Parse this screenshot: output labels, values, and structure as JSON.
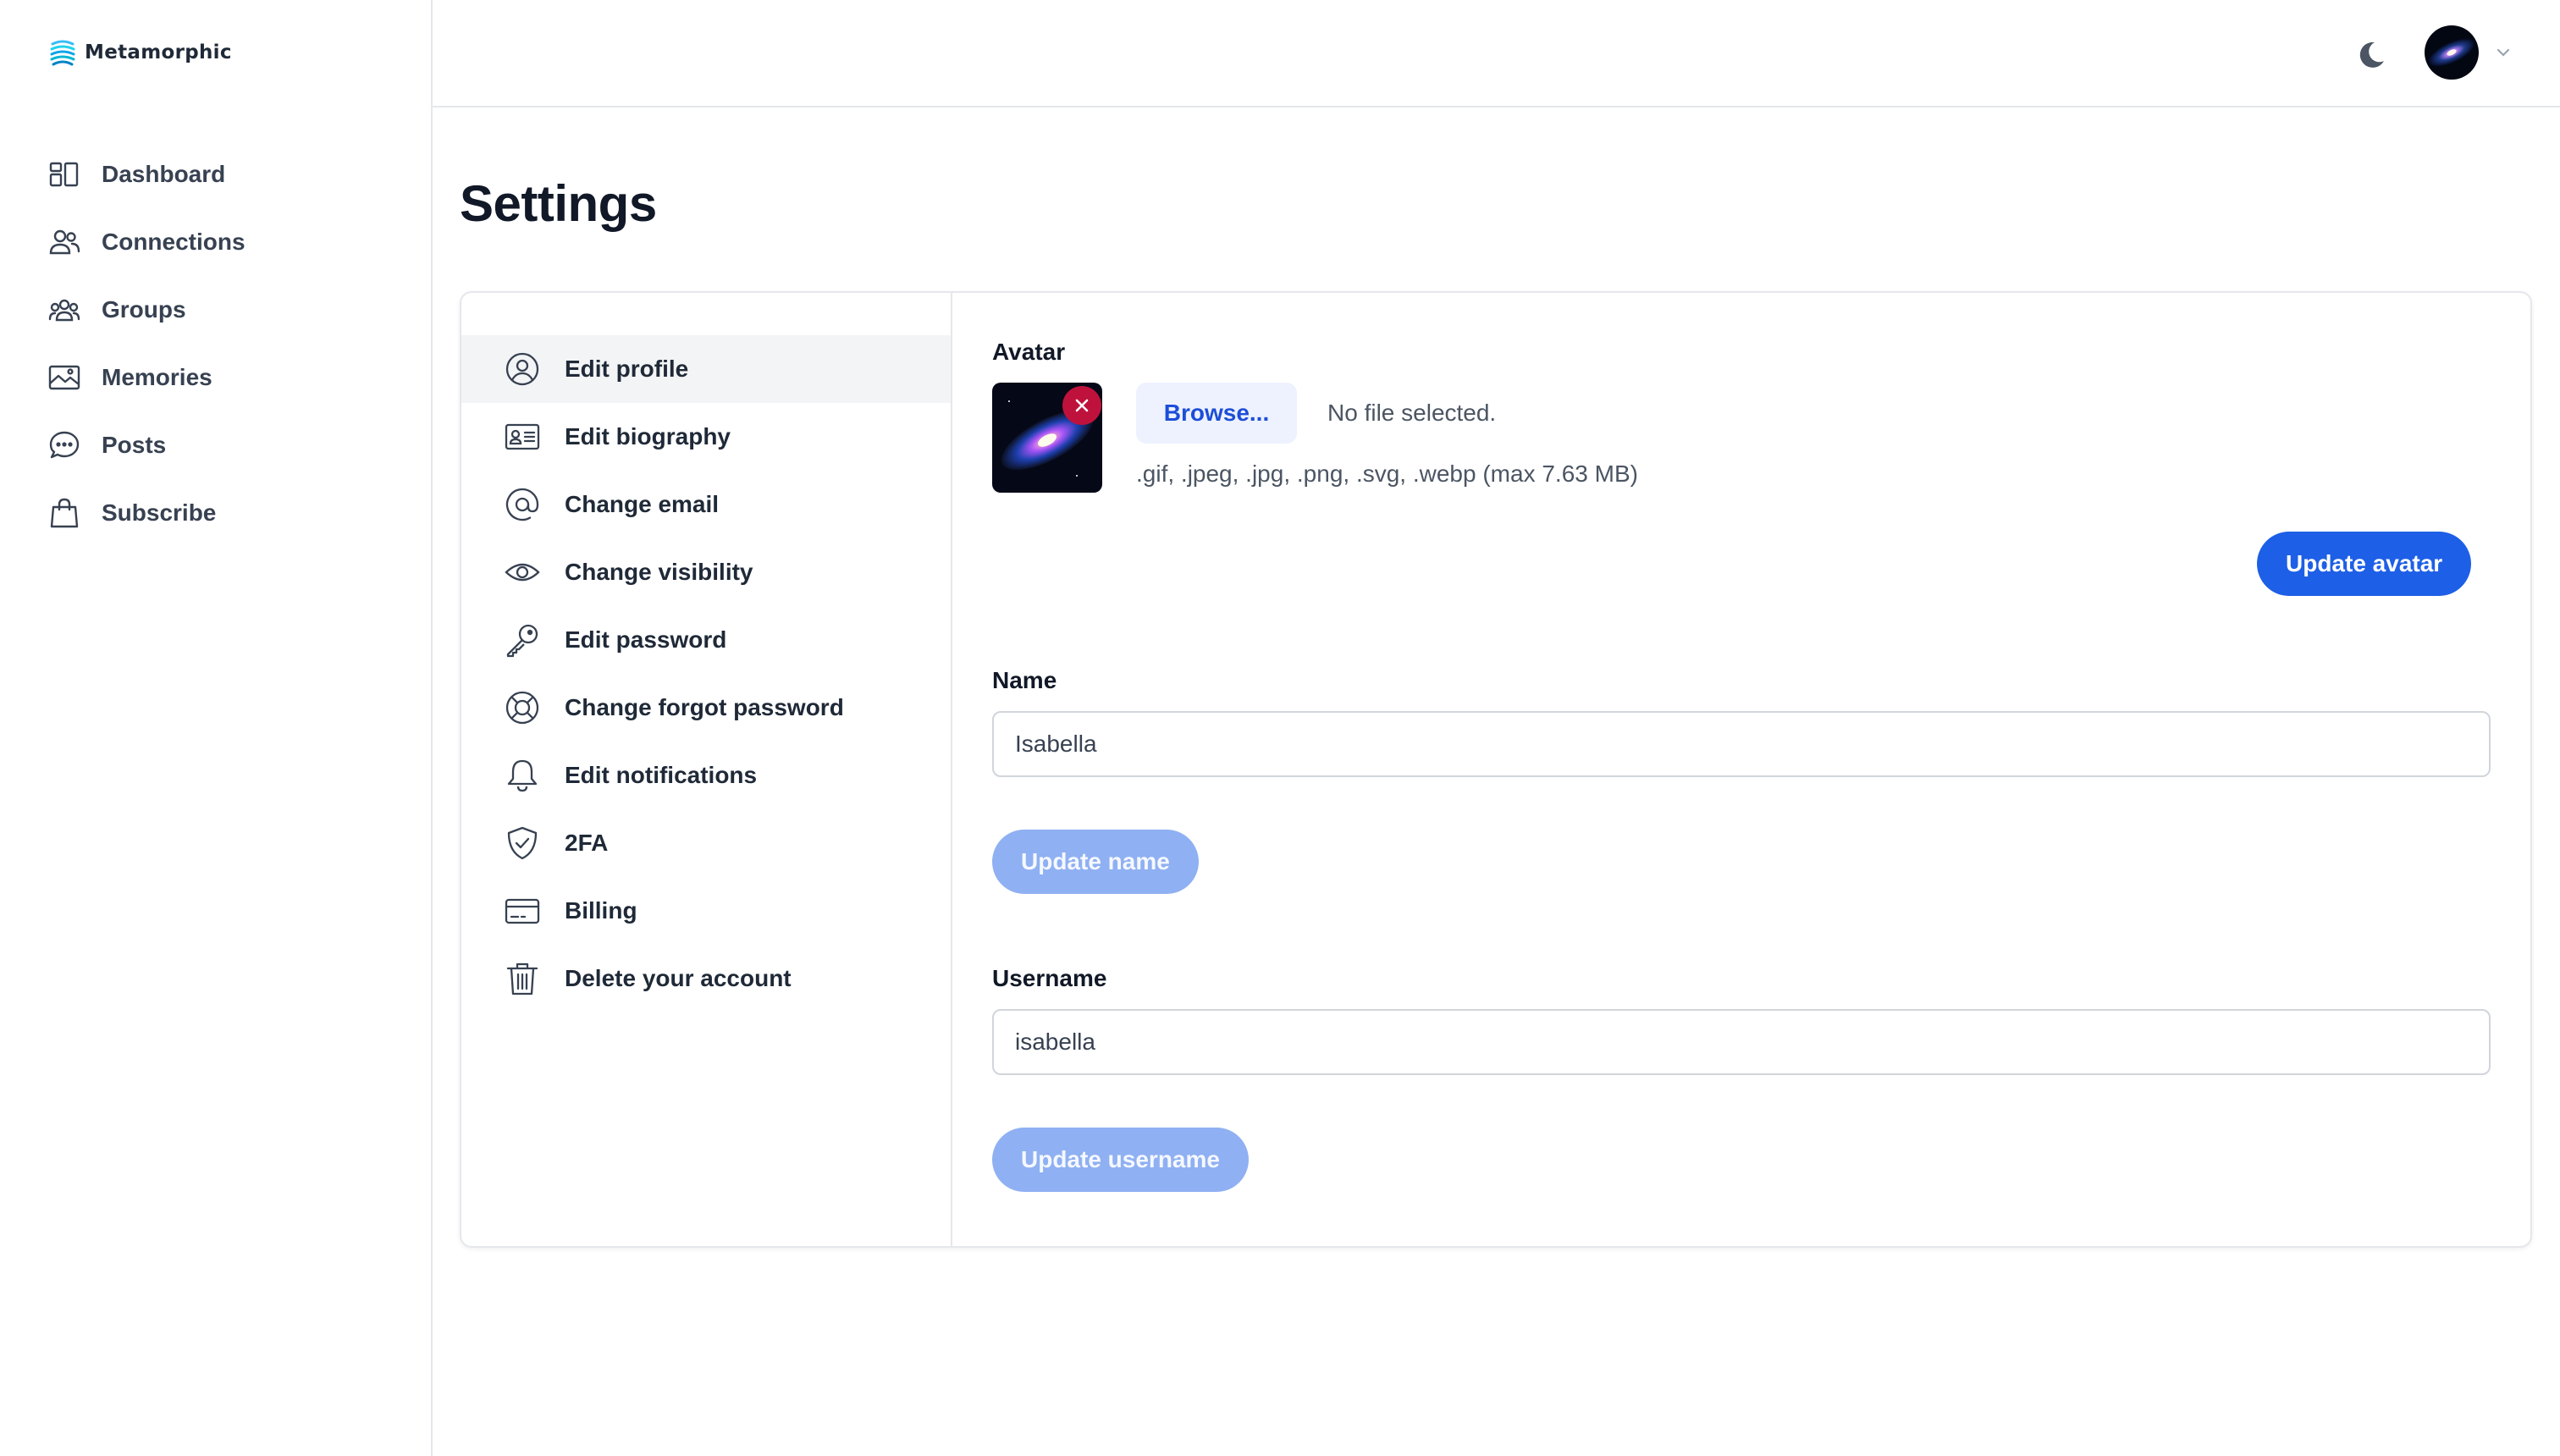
{
  "brand": {
    "name": "Metamorphic"
  },
  "sidebar": {
    "items": [
      {
        "label": "Dashboard"
      },
      {
        "label": "Connections"
      },
      {
        "label": "Groups"
      },
      {
        "label": "Memories"
      },
      {
        "label": "Posts"
      },
      {
        "label": "Subscribe"
      }
    ]
  },
  "page": {
    "title": "Settings"
  },
  "settings_menu": {
    "active": "Edit profile",
    "items": [
      {
        "label": "Edit profile",
        "icon": "user-circle-icon"
      },
      {
        "label": "Edit biography",
        "icon": "id-card-icon"
      },
      {
        "label": "Change email",
        "icon": "at-sign-icon"
      },
      {
        "label": "Change visibility",
        "icon": "eye-icon"
      },
      {
        "label": "Edit password",
        "icon": "key-icon"
      },
      {
        "label": "Change forgot password",
        "icon": "lifebuoy-icon"
      },
      {
        "label": "Edit notifications",
        "icon": "bell-icon"
      },
      {
        "label": "2FA",
        "icon": "shield-check-icon"
      },
      {
        "label": "Billing",
        "icon": "credit-card-icon"
      },
      {
        "label": "Delete your account",
        "icon": "trash-icon"
      }
    ]
  },
  "avatar_section": {
    "label": "Avatar",
    "browse_label": "Browse...",
    "file_status": "No file selected.",
    "hint": ".gif, .jpeg, .jpg, .png, .svg, .webp (max 7.63 MB)",
    "update_label": "Update avatar"
  },
  "name_section": {
    "label": "Name",
    "value": "Isabella",
    "update_label": "Update name"
  },
  "username_section": {
    "label": "Username",
    "value": "isabella",
    "update_label": "Update username"
  },
  "colors": {
    "primary": "#1d5fe6",
    "primary_disabled": "#8fb0f2",
    "danger": "#be123c",
    "active_bg": "#f3f4f6"
  }
}
